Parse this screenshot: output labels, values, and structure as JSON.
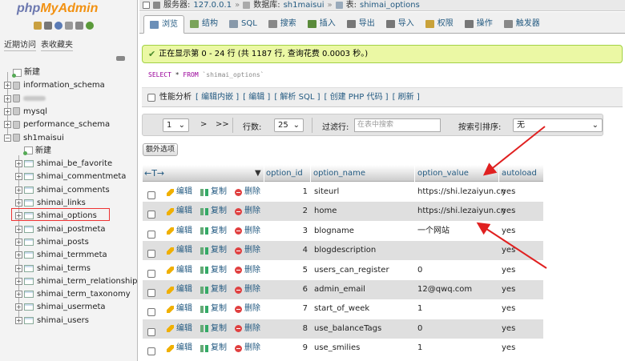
{
  "left": {
    "logo": {
      "php": "php",
      "my": "My",
      "admin": "Admin"
    },
    "tabs": [
      "近期访问",
      "表收藏夹"
    ],
    "tree": [
      {
        "label": "新建",
        "kind": "new",
        "level": 0
      },
      {
        "label": "information_schema",
        "kind": "db",
        "level": 0
      },
      {
        "label": "",
        "kind": "db-blurred",
        "level": 0
      },
      {
        "label": "mysql",
        "kind": "db",
        "level": 0
      },
      {
        "label": "performance_schema",
        "kind": "db",
        "level": 0
      },
      {
        "label": "sh1maisui",
        "kind": "db-open",
        "level": 0
      },
      {
        "label": "新建",
        "kind": "new",
        "level": 1
      },
      {
        "label": "shimai_be_favorite",
        "kind": "table",
        "level": 1
      },
      {
        "label": "shimai_commentmeta",
        "kind": "table",
        "level": 1
      },
      {
        "label": "shimai_comments",
        "kind": "table",
        "level": 1
      },
      {
        "label": "shimai_links",
        "kind": "table",
        "level": 1
      },
      {
        "label": "shimai_options",
        "kind": "table",
        "level": 1,
        "highlighted": true
      },
      {
        "label": "shimai_postmeta",
        "kind": "table",
        "level": 1
      },
      {
        "label": "shimai_posts",
        "kind": "table",
        "level": 1
      },
      {
        "label": "shimai_termmeta",
        "kind": "table",
        "level": 1
      },
      {
        "label": "shimai_terms",
        "kind": "table",
        "level": 1
      },
      {
        "label": "shimai_term_relationships",
        "kind": "table",
        "level": 1
      },
      {
        "label": "shimai_term_taxonomy",
        "kind": "table",
        "level": 1
      },
      {
        "label": "shimai_usermeta",
        "kind": "table",
        "level": 1
      },
      {
        "label": "shimai_users",
        "kind": "table",
        "level": 1
      }
    ]
  },
  "breadcrumb": {
    "server_label": "服务器:",
    "server": "127.0.0.1",
    "db_label": "数据库:",
    "db": "sh1maisui",
    "table_label": "表:",
    "table": "shimai_options",
    "sep": "»"
  },
  "tabs": [
    {
      "label": "浏览",
      "icon": "browse-icon",
      "color": "#6b8fb8"
    },
    {
      "label": "结构",
      "icon": "structure-icon",
      "color": "#7aa35a"
    },
    {
      "label": "SQL",
      "icon": "sql-icon",
      "color": "#8899aa"
    },
    {
      "label": "搜索",
      "icon": "search-icon",
      "color": "#888888"
    },
    {
      "label": "插入",
      "icon": "insert-icon",
      "color": "#5a8a3a"
    },
    {
      "label": "导出",
      "icon": "export-icon",
      "color": "#777777"
    },
    {
      "label": "导入",
      "icon": "import-icon",
      "color": "#777777"
    },
    {
      "label": "权限",
      "icon": "privileges-icon",
      "color": "#c9a23a"
    },
    {
      "label": "操作",
      "icon": "operations-icon",
      "color": "#777777"
    },
    {
      "label": "触发器",
      "icon": "triggers-icon",
      "color": "#888888"
    }
  ],
  "success_message": "正在显示第 0 - 24 行 (共 1187 行, 查询花费 0.0003 秒。)",
  "sql": {
    "select": "SELECT",
    "star": "*",
    "from": "FROM",
    "table": "`shimai_options`"
  },
  "profiling": {
    "label": "性能分析",
    "links": [
      "[ 编辑内嵌 ]",
      "[ 编辑 ]",
      "[ 解析 SQL ]",
      "[ 创建 PHP 代码 ]",
      "[ 刷新 ]"
    ]
  },
  "nav": {
    "page": "1",
    "next": ">",
    "last": ">>",
    "rows_label": "行数:",
    "rows": "25",
    "filter_label": "过滤行:",
    "filter_placeholder": "在表中搜索",
    "sort_label": "按索引排序:",
    "sort_value": "无"
  },
  "extra_button": "额外选项",
  "table": {
    "headers": [
      "option_id",
      "option_name",
      "option_value",
      "autoload"
    ],
    "action_labels": {
      "edit": "编辑",
      "copy": "复制",
      "delete": "删除"
    },
    "rows": [
      {
        "id": "1",
        "name": "siteurl",
        "value": "https://shi.lezaiyun.cn",
        "autoload": "yes"
      },
      {
        "id": "2",
        "name": "home",
        "value": "https://shi.lezaiyun.cn",
        "autoload": "yes"
      },
      {
        "id": "3",
        "name": "blogname",
        "value": "一个网站",
        "autoload": "yes"
      },
      {
        "id": "4",
        "name": "blogdescription",
        "value": "",
        "autoload": "yes"
      },
      {
        "id": "5",
        "name": "users_can_register",
        "value": "0",
        "autoload": "yes"
      },
      {
        "id": "6",
        "name": "admin_email",
        "value": "12@qwq.com",
        "autoload": "yes"
      },
      {
        "id": "7",
        "name": "start_of_week",
        "value": "1",
        "autoload": "yes"
      },
      {
        "id": "8",
        "name": "use_balanceTags",
        "value": "0",
        "autoload": "yes"
      },
      {
        "id": "9",
        "name": "use_smilies",
        "value": "1",
        "autoload": "yes"
      }
    ]
  },
  "colors": {
    "accent": "#235a81",
    "success_bg": "#ebf8a4",
    "annotation": "#e02020"
  }
}
